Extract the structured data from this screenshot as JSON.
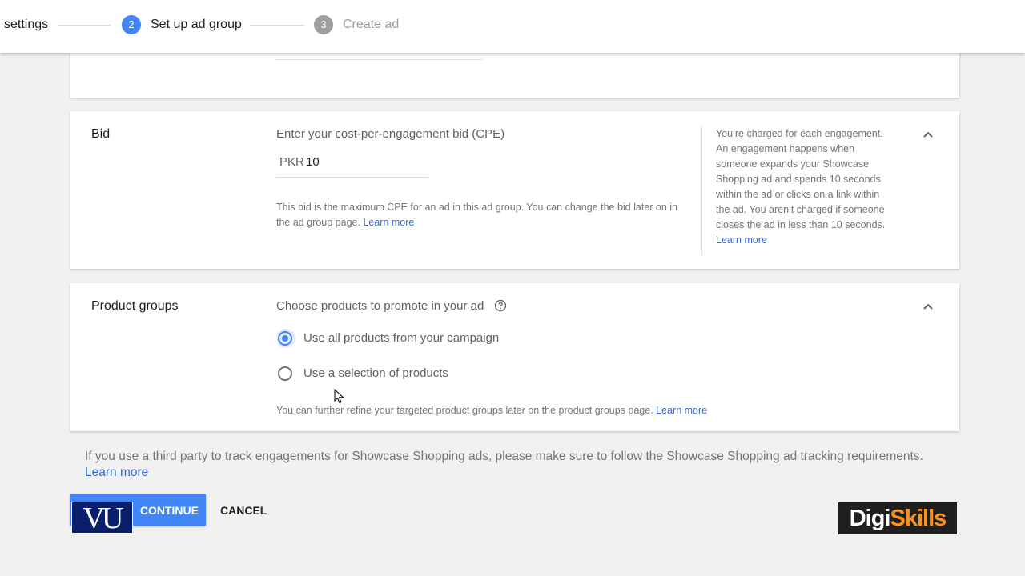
{
  "stepper": {
    "prev_label": "settings",
    "active_num": "2",
    "active_label": "Set up ad group",
    "next_num": "3",
    "next_label": "Create ad"
  },
  "bid": {
    "title": "Bid",
    "field_label": "Enter your cost-per-engagement bid (CPE)",
    "currency": "PKR",
    "value": "10",
    "helper_text": "This bid is the maximum CPE for an ad in this ad group. You can change the bid later on in the ad group page.",
    "helper_link": "Learn more",
    "info_text": "You’re charged for each engagement. An engagement happens when someone expands your Showcase Shopping ad and spends 10 seconds within the ad or clicks on a link within the ad. You aren’t charged if someone closes the ad in less than 10 seconds.",
    "info_link": "Learn more"
  },
  "product_groups": {
    "title": "Product groups",
    "field_label": "Choose products to promote in your ad",
    "options": [
      {
        "label": "Use all products from your campaign",
        "selected": true
      },
      {
        "label": "Use a selection of products",
        "selected": false
      }
    ],
    "helper_text": "You can further refine your targeted product groups later on the product groups page.",
    "helper_link": "Learn more"
  },
  "tracking_note": {
    "text": "If you use a third party to track engagements for Showcase Shopping ads, please make sure to follow the Showcase Shopping ad tracking requirements.",
    "link": "Learn more"
  },
  "actions": {
    "continue_label": "CONTINUE",
    "cancel_label": "CANCEL"
  },
  "logos": {
    "vu": "VU",
    "digi_part1": "Digi",
    "digi_part2": "Skills"
  },
  "colors": {
    "accent": "#4285f4",
    "link": "#3367d6",
    "background": "#f1f1f1"
  }
}
